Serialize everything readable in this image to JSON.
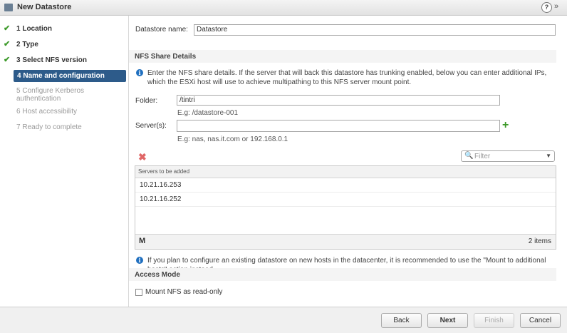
{
  "window": {
    "title": "New Datastore",
    "help_icon": "?",
    "expand_icon": "»"
  },
  "steps": [
    {
      "number": "1",
      "label": "Location",
      "state": "done"
    },
    {
      "number": "2",
      "label": "Type",
      "state": "done"
    },
    {
      "number": "3",
      "label": "Select NFS version",
      "state": "done"
    },
    {
      "number": "4",
      "label": "Name and configuration",
      "state": "active"
    },
    {
      "number": "5",
      "label": "Configure Kerberos authentication",
      "state": "pending"
    },
    {
      "number": "6",
      "label": "Host accessibility",
      "state": "pending"
    },
    {
      "number": "7",
      "label": "Ready to complete",
      "state": "pending"
    }
  ],
  "form": {
    "datastore_name_label": "Datastore name:",
    "datastore_name_value": "Datastore",
    "nfs_share_header": "NFS Share Details",
    "nfs_info": "Enter the NFS share details. If the server that will back this datastore has trunking enabled, below you can enter additional IPs, which the ESXi host will use to achieve multipathing to this NFS server mount point.",
    "folder_label": "Folder:",
    "folder_value": "/tintri",
    "folder_hint": "E.g: /datastore-001",
    "servers_label": "Server(s):",
    "servers_value": "",
    "servers_hint": "E.g: nas, nas.it.com or 192.168.0.1",
    "filter_placeholder": "Filter",
    "servers_table": {
      "header": "Servers to be added",
      "rows": [
        "10.21.16.253",
        "10.21.16.252"
      ],
      "count": "2 items"
    },
    "mount_info": "If you plan to configure an existing datastore on new hosts in the datacenter, it is recommended to use the \"Mount to additional hosts\" action instead.",
    "access_mode_header": "Access Mode",
    "readonly_label": "Mount NFS as read-only",
    "readonly_checked": false
  },
  "buttons": {
    "back": "Back",
    "next": "Next",
    "finish": "Finish",
    "cancel": "Cancel"
  },
  "icons": {
    "check": "✔",
    "info": "i",
    "add": "+",
    "remove": "✖",
    "search": "🔍",
    "dropdown": "▼",
    "binoculars": "M"
  },
  "colors": {
    "accent": "#2d5b8a",
    "success": "#3d9a2a",
    "info": "#1f6fbf",
    "remove": "#e06666"
  }
}
